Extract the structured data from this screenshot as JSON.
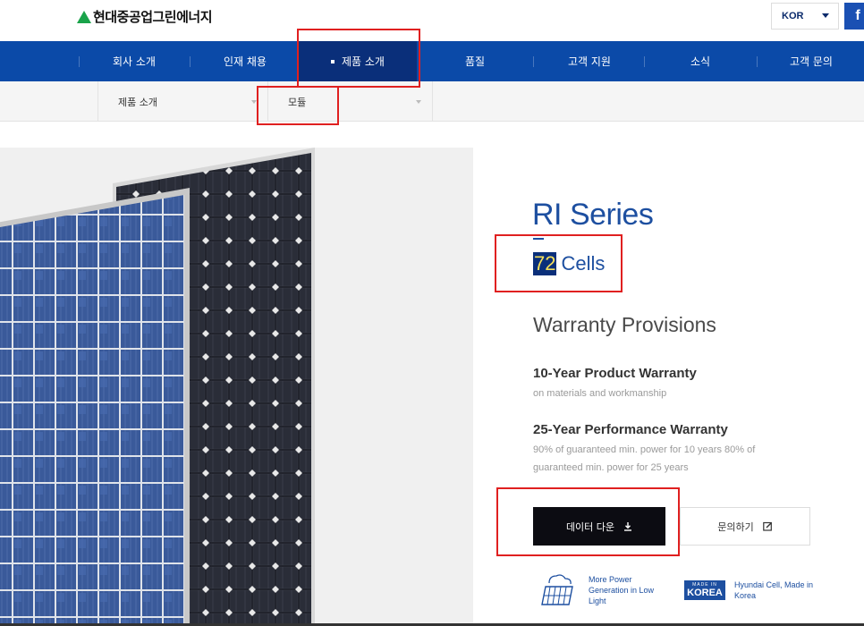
{
  "header": {
    "logo_text": "현대중공업그린에너지",
    "language": "KOR",
    "facebook_label": "f"
  },
  "nav": {
    "items": [
      {
        "label": "회사 소개"
      },
      {
        "label": "인재 채용"
      },
      {
        "label": "제품 소개"
      },
      {
        "label": "품질"
      },
      {
        "label": "고객 지원"
      },
      {
        "label": "소식"
      },
      {
        "label": "고객 문의"
      }
    ],
    "active_index": 2
  },
  "subnav": {
    "level1": "제품 소개",
    "level2": "모듈"
  },
  "product": {
    "series": "RI Series",
    "cells_number": "72",
    "cells_label": "Cells",
    "warranty_title": "Warranty Provisions",
    "warranties": [
      {
        "heading": "10-Year Product Warranty",
        "text": "on materials and workmanship"
      },
      {
        "heading": "25-Year Performance Warranty",
        "text": "90% of guaranteed min. power for 10 years 80% of guaranteed min. power for 25 years"
      }
    ],
    "download_button": "데이터 다운",
    "inquiry_button": "문의하기",
    "features": [
      {
        "icon": "solar-panel-cloud-icon",
        "text": "More Power Generation in Low Light"
      },
      {
        "icon": "made-in-korea-badge",
        "badge_small": "MADE IN",
        "badge_big": "KOREA",
        "text": "Hyundai Cell, Made in Korea"
      }
    ]
  },
  "colors": {
    "nav_bg": "#0b4aa8",
    "nav_active": "#0a2f7a",
    "brand_blue": "#1d4fa0",
    "highlight_red": "#e02020",
    "logo_green": "#1aa34a"
  }
}
